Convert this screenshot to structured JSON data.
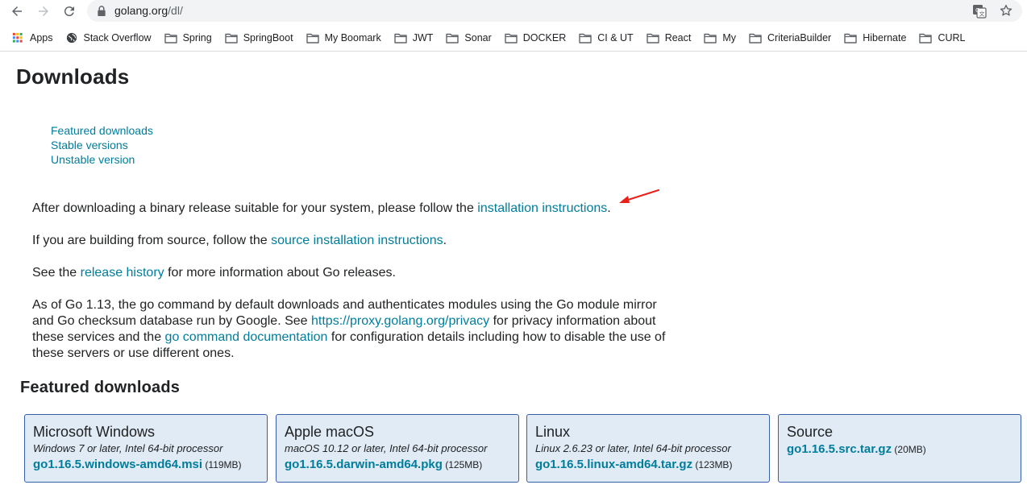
{
  "browser": {
    "url_host": "golang.org",
    "url_path": "/dl/"
  },
  "bookmarks": [
    {
      "label": "Apps",
      "icon": "apps-grid-icon"
    },
    {
      "label": "Stack Overflow",
      "icon": "globe-icon"
    },
    {
      "label": "Spring",
      "icon": "folder-icon"
    },
    {
      "label": "SpringBoot",
      "icon": "folder-icon"
    },
    {
      "label": "My Boomark",
      "icon": "folder-icon"
    },
    {
      "label": "JWT",
      "icon": "folder-icon"
    },
    {
      "label": "Sonar",
      "icon": "folder-icon"
    },
    {
      "label": "DOCKER",
      "icon": "folder-icon"
    },
    {
      "label": "CI & UT",
      "icon": "folder-icon"
    },
    {
      "label": "React",
      "icon": "folder-icon"
    },
    {
      "label": "My",
      "icon": "folder-icon"
    },
    {
      "label": "CriteriaBuilder",
      "icon": "folder-icon"
    },
    {
      "label": "Hibernate",
      "icon": "folder-icon"
    },
    {
      "label": "CURL",
      "icon": "folder-icon"
    }
  ],
  "page": {
    "title": "Downloads",
    "toc": [
      "Featured downloads",
      "Stable versions",
      "Unstable version"
    ],
    "p1": {
      "before": "After downloading a binary release suitable for your system, please follow the ",
      "link": "installation instructions",
      "after": "."
    },
    "p2": {
      "before": "If you are building from source, follow the ",
      "link": "source installation instructions",
      "after": "."
    },
    "p3": {
      "before": "See the ",
      "link": "release history",
      "after": " for more information about Go releases."
    },
    "p4": {
      "part1": "As of Go 1.13, the go command by default downloads and authenticates modules using the Go module mirror and Go checksum database run by Google. See ",
      "link1": "https://proxy.golang.org/privacy",
      "part2": " for privacy information about these services and the ",
      "link2": "go command documentation",
      "part3": " for configuration details including how to disable the use of these servers or use different ones."
    },
    "featured_title": "Featured downloads",
    "featured": [
      {
        "os": "Microsoft Windows",
        "req": "Windows 7 or later, Intel 64-bit processor",
        "file": "go1.16.5.windows-amd64.msi",
        "size": "(119MB)"
      },
      {
        "os": "Apple macOS",
        "req": "macOS 10.12 or later, Intel 64-bit processor",
        "file": "go1.16.5.darwin-amd64.pkg",
        "size": "(125MB)"
      },
      {
        "os": "Linux",
        "req": "Linux 2.6.23 or later, Intel 64-bit processor",
        "file": "go1.16.5.linux-amd64.tar.gz",
        "size": "(123MB)"
      },
      {
        "os": "Source",
        "req": "",
        "file": "go1.16.5.src.tar.gz",
        "size": "(20MB)"
      }
    ]
  },
  "colors": {
    "link": "#007d9c",
    "card_bg": "#e0ebf5",
    "card_border": "#375eab",
    "annotation_arrow": "#e8221b"
  }
}
